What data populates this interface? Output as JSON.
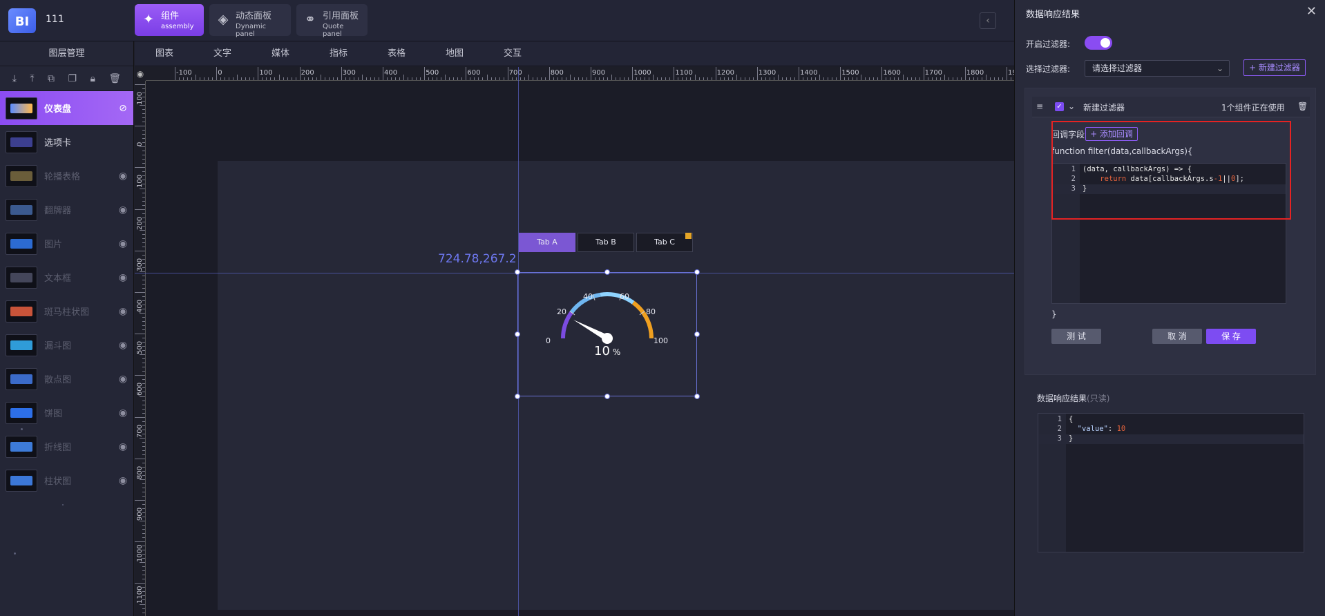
{
  "app": {
    "logo": "BI",
    "project_name": "111"
  },
  "top_tabs": [
    {
      "label": "组件",
      "sub": "assembly",
      "icon": "puzzle-icon",
      "active": true
    },
    {
      "label": "动态面板",
      "sub": "Dynamic panel",
      "icon": "layers-icon",
      "active": false
    },
    {
      "label": "引用面板",
      "sub": "Quote panel",
      "icon": "link-icon",
      "active": false
    }
  ],
  "left_panel": {
    "title": "图层管理",
    "tools": [
      "download-icon",
      "upload-icon",
      "copy-icon",
      "paste-icon",
      "lock-icon",
      "trash-icon"
    ],
    "layers": [
      {
        "name": "仪表盘",
        "state": "active",
        "eye": "eye-off-icon"
      },
      {
        "name": "选项卡",
        "state": "visible",
        "eye": ""
      },
      {
        "name": "轮播表格",
        "state": "hidden",
        "eye": "eye-icon"
      },
      {
        "name": "翻牌器",
        "state": "hidden",
        "eye": "eye-icon"
      },
      {
        "name": "图片",
        "state": "hidden",
        "eye": "eye-icon"
      },
      {
        "name": "文本框",
        "state": "hidden",
        "eye": "eye-icon"
      },
      {
        "name": "斑马柱状图",
        "state": "hidden",
        "eye": "eye-icon"
      },
      {
        "name": "漏斗图",
        "state": "hidden",
        "eye": "eye-icon"
      },
      {
        "name": "散点图",
        "state": "hidden",
        "eye": "eye-icon"
      },
      {
        "name": "饼图",
        "state": "hidden",
        "eye": "eye-icon"
      },
      {
        "name": "折线图",
        "state": "hidden",
        "eye": "eye-icon"
      },
      {
        "name": "柱状图",
        "state": "hidden",
        "eye": "eye-icon"
      }
    ]
  },
  "categories": [
    "图表",
    "文字",
    "媒体",
    "指标",
    "表格",
    "地图",
    "交互"
  ],
  "ruler": {
    "h_labels": [
      "-100",
      "0",
      "100",
      "200",
      "300",
      "400",
      "500",
      "600",
      "700",
      "800",
      "900",
      "1000",
      "1100",
      "1200",
      "1300",
      "1400",
      "1500",
      "1600",
      "1700",
      "1800",
      "190"
    ],
    "v_labels": [
      "100",
      "0",
      "100",
      "200",
      "300",
      "400",
      "500",
      "600",
      "700",
      "800",
      "900",
      "1000",
      "1100"
    ]
  },
  "canvas": {
    "coord_readout": "724.78,267.2",
    "tabs": [
      "Tab A",
      "Tab B",
      "Tab C"
    ],
    "gauge": {
      "value": "10",
      "unit": "%",
      "min": 0,
      "max": 100,
      "current": 10,
      "ticks": [
        "0",
        "20",
        "40",
        "60",
        "80",
        "100"
      ]
    }
  },
  "right_panel": {
    "title": "数据响应结果",
    "enable_filter_label": "开启过滤器:",
    "enable_filter_on": true,
    "select_filter_label": "选择过滤器:",
    "select_placeholder": "请选择过滤器",
    "new_filter_btn": "+ 新建过滤器",
    "filter": {
      "name": "新建过滤器",
      "usage": "1个组件正在使用",
      "callback_label": "回调字段",
      "add_callback_btn": "+ 添加回调",
      "signature": "function filter(data,callbackArgs){",
      "code_lines": [
        {
          "n": "1",
          "text": "(data, callbackArgs) => {"
        },
        {
          "n": "2",
          "text": "    return data[callbackArgs.s-1||0];"
        },
        {
          "n": "3",
          "text": "}"
        }
      ],
      "close_brace": "}",
      "test_btn": "测 试",
      "cancel_btn": "取 消",
      "save_btn": "保 存"
    },
    "response_title": "数据响应结果",
    "response_readonly": "(只读)",
    "response_lines": [
      {
        "n": "1",
        "text": "{"
      },
      {
        "n": "2",
        "key": "\"value\"",
        "val": "10"
      },
      {
        "n": "3",
        "text": "}"
      }
    ]
  },
  "colors": {
    "accent": "#8a4cf2",
    "highlight_box": "#e52323",
    "guide": "#5a63c8"
  }
}
